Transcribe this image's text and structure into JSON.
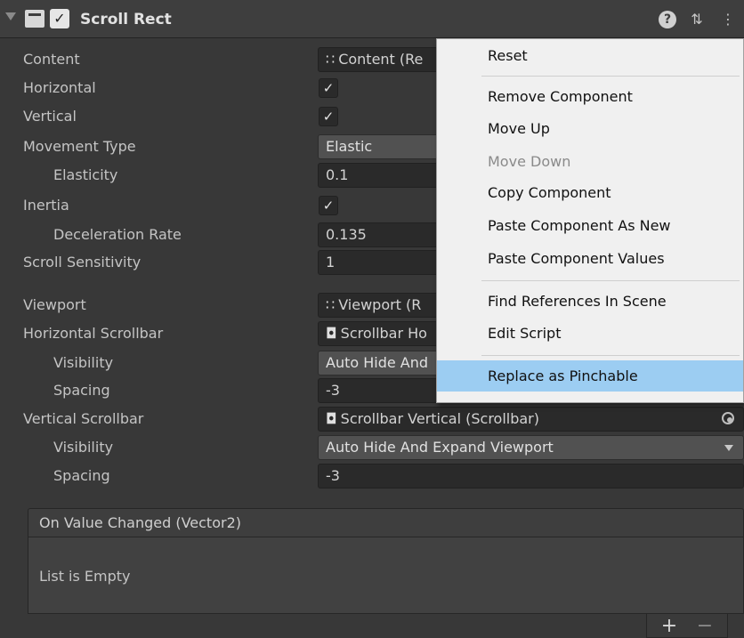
{
  "component": {
    "title": "Scroll Rect",
    "enabled_check": "✓",
    "help_icon": "?",
    "presets_icon": "⇅",
    "menu_icon": "⋮"
  },
  "properties": {
    "content": {
      "label": "Content",
      "value": "Content (Re",
      "ref_glyph": "∷"
    },
    "horizontal": {
      "label": "Horizontal",
      "check": "✓"
    },
    "vertical": {
      "label": "Vertical",
      "check": "✓"
    },
    "movement_type": {
      "label": "Movement Type",
      "value": "Elastic"
    },
    "elasticity": {
      "label": "Elasticity",
      "value": "0.1"
    },
    "inertia": {
      "label": "Inertia",
      "check": "✓"
    },
    "deceleration_rate": {
      "label": "Deceleration Rate",
      "value": "0.135"
    },
    "scroll_sensitivity": {
      "label": "Scroll Sensitivity",
      "value": "1"
    },
    "viewport": {
      "label": "Viewport",
      "value": "Viewport (R",
      "ref_glyph": "∷"
    },
    "horizontal_scrollbar": {
      "label": "Horizontal Scrollbar",
      "value": "Scrollbar Ho",
      "ref_glyph": "◘"
    },
    "h_visibility": {
      "label": "Visibility",
      "value": "Auto Hide And"
    },
    "h_spacing": {
      "label": "Spacing",
      "value": "-3"
    },
    "vertical_scrollbar": {
      "label": "Vertical Scrollbar",
      "value": "Scrollbar Vertical (Scrollbar)",
      "ref_glyph": "◘"
    },
    "v_visibility": {
      "label": "Visibility",
      "value": "Auto Hide And Expand Viewport"
    },
    "v_spacing": {
      "label": "Spacing",
      "value": "-3"
    }
  },
  "event": {
    "header": "On Value Changed (Vector2)",
    "empty_text": "List is Empty",
    "add_label": "+",
    "remove_label": "−"
  },
  "context_menu": {
    "items": [
      {
        "label": "Reset",
        "disabled": false
      },
      {
        "label": "Remove Component",
        "disabled": false
      },
      {
        "label": "Move Up",
        "disabled": false
      },
      {
        "label": "Move Down",
        "disabled": true
      },
      {
        "label": "Copy Component",
        "disabled": false
      },
      {
        "label": "Paste Component As New",
        "disabled": false
      },
      {
        "label": "Paste Component Values",
        "disabled": false
      },
      {
        "label": "Find References In Scene",
        "disabled": false
      },
      {
        "label": "Edit Script",
        "disabled": false
      },
      {
        "label": "Replace as Pinchable",
        "disabled": false,
        "highlighted": true
      }
    ]
  },
  "colors": {
    "background": "#383838",
    "field": "#2a2a2a",
    "menu_background": "#f0f0f0",
    "menu_highlight": "#9ccdf2"
  }
}
